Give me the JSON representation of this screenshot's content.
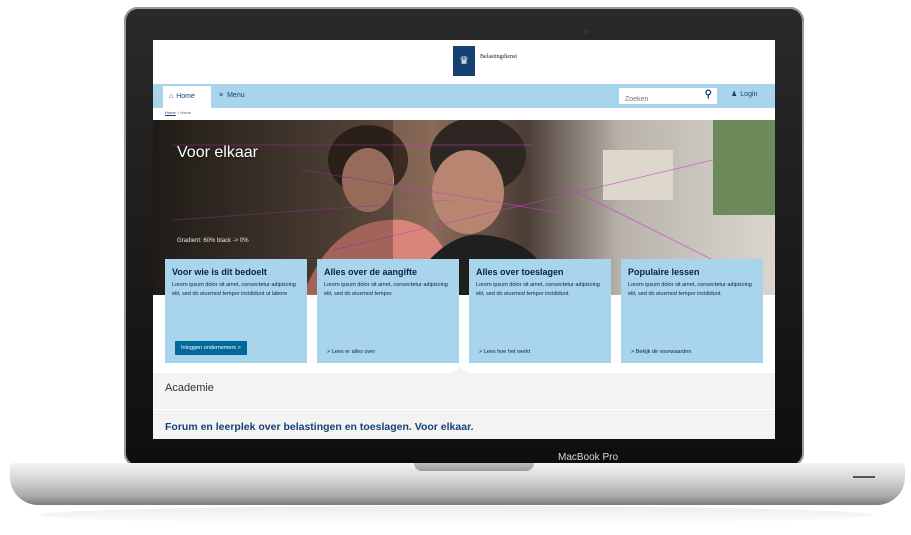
{
  "device": {
    "label": "MacBook Pro"
  },
  "header": {
    "logo_text": "Belastingdienst"
  },
  "nav": {
    "home_label": "Home",
    "menu_label": "Menu",
    "search_placeholder": "Zoeken",
    "login_label": "Login"
  },
  "breadcrumb": {
    "home": "Home",
    "separator": "> Home"
  },
  "hero": {
    "title": "Voor elkaar",
    "note": "Gradient: 60% black -> 0%"
  },
  "cards": [
    {
      "title": "Voor wie is dit bedoelt",
      "text": "Lorem ipsum dolor sit amet, consectetur adipiscing elit, sed do eiusmod tempor incididunt ut labore",
      "action": "Inloggen ondernemers >"
    },
    {
      "title": "Alles over de aangifte",
      "text": "Lorem ipsum dolor sit amet, consectetur adipiscing elit, sed do eiusmod tempor.",
      "action": ">  Lees er alles over"
    },
    {
      "title": "Alles over toeslagen",
      "text": "Lorem ipsum dolor sit amet, consectetur adipiscing elit, sed do eiusmod tempor incididunt.",
      "action": ">  Lees hoe het werkt"
    },
    {
      "title": "Populaire lessen",
      "text": "Lorem ipsum dolor sit amet, consectetur adipiscing elit, sed do eiusmod tempor incididunt.",
      "action": ">  Bekijk de voorwaarden"
    }
  ],
  "academie": {
    "title": "Academie",
    "subtitle": "Forum en leerplek over belastingen en toeslagen. Voor elkaar."
  },
  "colors": {
    "navbar": "#a8d5ec",
    "brand_blue": "#154273",
    "button_blue": "#01689b"
  },
  "icons": [
    "home-icon",
    "menu-icon",
    "search-icon",
    "user-icon",
    "logo-crest-icon"
  ]
}
